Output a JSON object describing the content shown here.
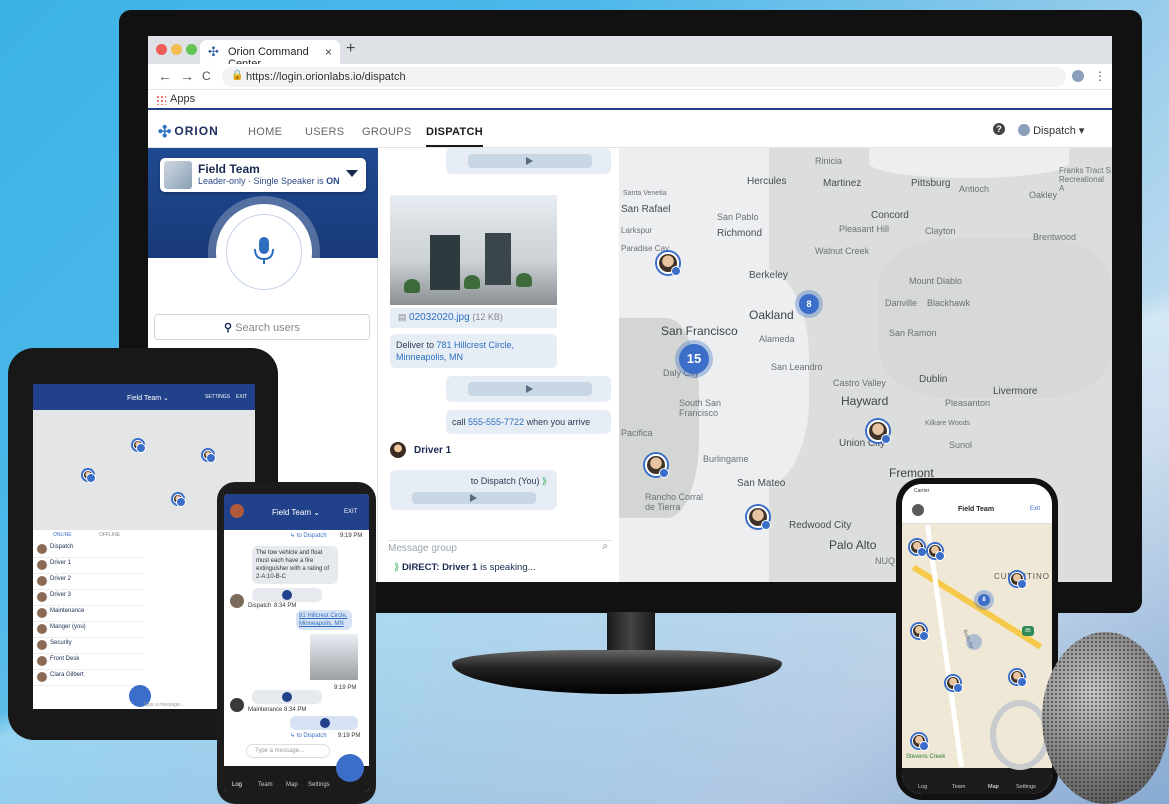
{
  "browser": {
    "tab_title": "Orion Command Center",
    "tab_close": "×",
    "new_tab": "+",
    "url": "https://login.orionlabs.io/dispatch",
    "bookmarks_label": "Apps",
    "back": "←",
    "forward": "→",
    "reload": "C",
    "menu": "⋮"
  },
  "app": {
    "logo_text": "ORION",
    "nav": [
      "HOME",
      "USERS",
      "GROUPS",
      "DISPATCH"
    ],
    "active_nav": "DISPATCH",
    "help": "?",
    "user_label": "Dispatch",
    "user_caret": "▾"
  },
  "left_panel": {
    "team_name": "Field Team",
    "team_subtitle_prefix": "Leader-only · Single Speaker is ",
    "team_subtitle_state": "ON",
    "search_placeholder": "Search users"
  },
  "chat": {
    "file_name": "02032020.jpg",
    "file_size": "(12 KB)",
    "deliver_prefix": "Deliver to ",
    "deliver_link": "781 Hillcrest Circle, Minneapolis, MN",
    "call_prefix": "call ",
    "call_link": "555-555-7722",
    "call_suffix": " when you arrive",
    "driver_name": "Driver 1",
    "to_dispatch": "to Dispatch (You)",
    "input_placeholder": "Message group",
    "direct_prefix": "DIRECT:",
    "direct_name": "Driver 1",
    "direct_suffix": "is speaking..."
  },
  "map": {
    "labels": {
      "rinicia": "Rinicia",
      "hercules": "Hercules",
      "martinez": "Martinez",
      "pittsburg": "Pittsburg",
      "antioch": "Antioch",
      "oakley": "Oakley",
      "franks": "Franks Tract S Recreational A",
      "santa_venetia": "Santa Venetia",
      "san_rafael": "San Rafael",
      "san_pablo": "San Pablo",
      "richmond": "Richmond",
      "concord": "Concord",
      "pleasant_hill": "Pleasant Hill",
      "clayton": "Clayton",
      "larkspur": "Larkspur",
      "brentwood": "Brentwood",
      "paradise_cay": "Paradise Cay",
      "walnut_creek": "Walnut Creek",
      "berkeley": "Berkeley",
      "mount_diablo": "Mount Diablo",
      "danville": "Danville",
      "blackhawk": "Blackhawk",
      "oakland": "Oakland",
      "san_francisco": "San Francisco",
      "alameda": "Alameda",
      "san_ramon": "San Ramon",
      "daly_city": "Daly City",
      "san_leandro": "San Leandro",
      "castro_valley": "Castro Valley",
      "dublin": "Dublin",
      "livermore": "Livermore",
      "south_sf": "South San Francisco",
      "hayward": "Hayward",
      "pleasanton": "Pleasanton",
      "kilkare": "Kilkare Woods",
      "pacifica": "Pacifica",
      "union_city": "Union City",
      "sunol": "Sunol",
      "burlingame": "Burlingame",
      "fremont": "Fremont",
      "san_mateo": "San Mateo",
      "rancho": "Rancho Corral de Tierra",
      "redwood": "Redwood City",
      "palo_alto": "Palo Alto",
      "nuq": "NUQ"
    },
    "cluster_a": "8",
    "cluster_b": "15"
  },
  "tablet": {
    "title": "Field Team ⌄",
    "settings": "SETTINGS",
    "exit": "EXIT",
    "tab_online": "ONLINE",
    "tab_offline": "OFFLINE",
    "users": [
      "Dispatch",
      "Driver 1",
      "Driver 2",
      "Driver 3",
      "Maintenance",
      "Manger (you)",
      "Security",
      "Front Desk",
      "Clara Gilbert"
    ],
    "input": "Type a message..."
  },
  "phone": {
    "title": "Field Team ⌄",
    "exit": "EXIT",
    "to_dispatch": "↳ to Dispatch",
    "time1": "9:19 PM",
    "msg": "The tow vehicle and float must each have a fire extinguisher with a rating of 2-A:10-B-C",
    "sender1": "Dispatch",
    "sender1_time": "8:34 PM",
    "link": "81 Hillcrest Circle, Minneapolis, MN",
    "time2": "9:19 PM",
    "sender2": "Maintenance",
    "sender2_time": "8:34 PM",
    "time3": "9:19 PM",
    "input": "Type a message...",
    "nav": [
      "Log",
      "Team",
      "Map",
      "Settings"
    ]
  },
  "iphone": {
    "carrier": "Carrier",
    "title": "Field Team",
    "exit": "Exit",
    "city": "CUPERTINO",
    "road": "Bubb Rd",
    "badge": "8",
    "highway": "85",
    "park": "Stevens Creek",
    "nav": [
      "Log",
      "Team",
      "Map",
      "Settings"
    ]
  },
  "colors": {
    "brand_blue": "#21418a",
    "accent": "#3a6ec9",
    "background": "#4db8ea"
  }
}
